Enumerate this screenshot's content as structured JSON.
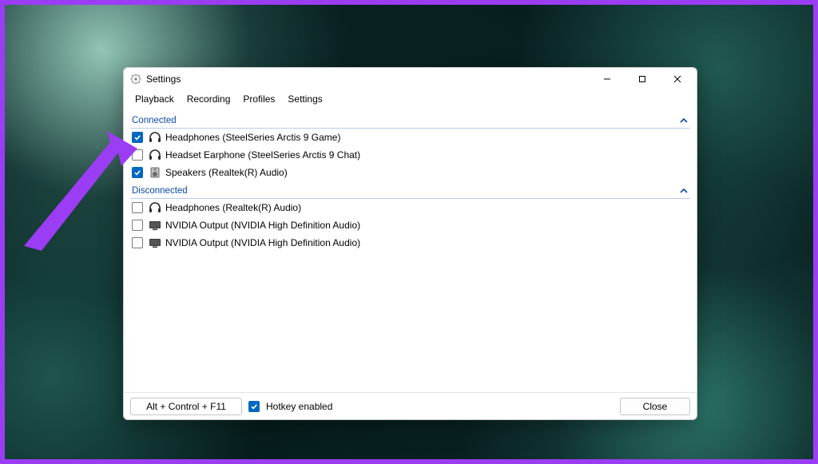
{
  "window": {
    "title": "Settings",
    "controls": {
      "minimize": "minimize",
      "maximize": "maximize",
      "close": "close"
    }
  },
  "tabs": [
    {
      "label": "Playback",
      "active": true
    },
    {
      "label": "Recording",
      "active": false
    },
    {
      "label": "Profiles",
      "active": false
    },
    {
      "label": "Settings",
      "active": false
    }
  ],
  "sections": {
    "connected": {
      "label": "Connected",
      "devices": [
        {
          "name": "Headphones (SteelSeries Arctis 9 Game)",
          "icon": "headphones",
          "checked": true
        },
        {
          "name": "Headset Earphone (SteelSeries Arctis 9 Chat)",
          "icon": "headphones",
          "checked": false
        },
        {
          "name": "Speakers (Realtek(R) Audio)",
          "icon": "speaker",
          "checked": true
        }
      ]
    },
    "disconnected": {
      "label": "Disconnected",
      "devices": [
        {
          "name": "Headphones (Realtek(R) Audio)",
          "icon": "headphones",
          "checked": false
        },
        {
          "name": "NVIDIA Output (NVIDIA High Definition Audio)",
          "icon": "monitor",
          "checked": false
        },
        {
          "name": "NVIDIA Output (NVIDIA High Definition Audio)",
          "icon": "monitor",
          "checked": false
        }
      ]
    }
  },
  "footer": {
    "hotkey": "Alt + Control + F11",
    "hotkey_enabled_label": "Hotkey enabled",
    "hotkey_enabled": true,
    "close_label": "Close"
  },
  "annotation": {
    "arrow_color": "#9b3df5"
  }
}
